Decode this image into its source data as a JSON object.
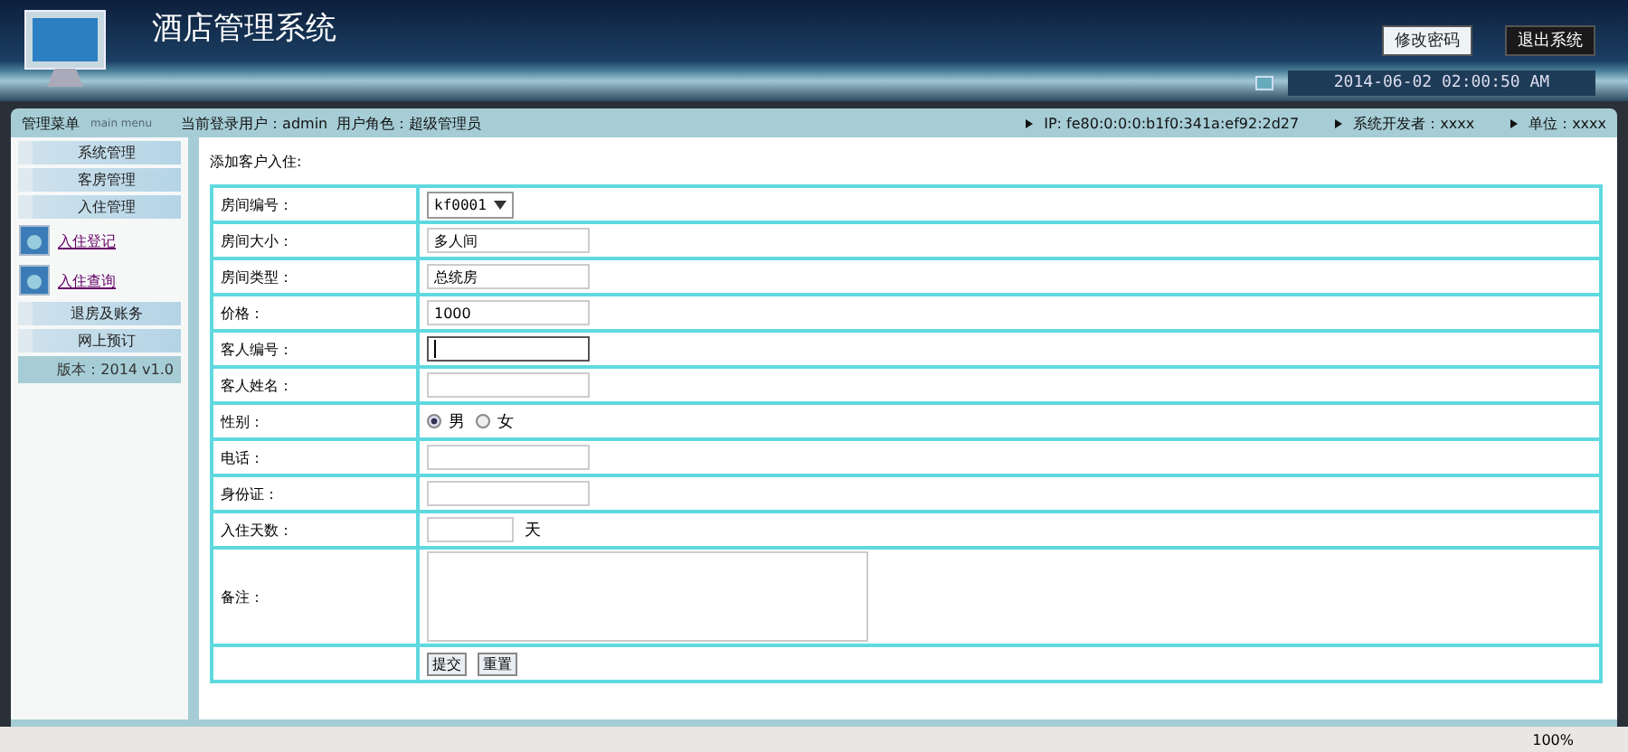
{
  "header": {
    "title": "酒店管理系统",
    "buttons": [
      {
        "label": "修改密码",
        "kind": "light"
      },
      {
        "label": "退出系统",
        "kind": "dark"
      }
    ],
    "datetime": "2014-06-02 02:00:50 AM"
  },
  "menu_bar": {
    "title": "管理菜单",
    "subtitle": "main menu",
    "user": "当前登录用户：admin  用户角色：超级管理员",
    "info": [
      "IP: fe80:0:0:0:b1f0:341a:ef92:2d27",
      "系统开发者：xxxx",
      "单位：xxxx"
    ]
  },
  "sidebar": {
    "items": [
      {
        "kind": "section",
        "label": "系统管理"
      },
      {
        "kind": "section",
        "label": "客房管理"
      },
      {
        "kind": "section",
        "label": "入住管理"
      },
      {
        "kind": "link",
        "label": "入住登记"
      },
      {
        "kind": "link",
        "label": "入住查询"
      },
      {
        "kind": "section",
        "label": "退房及账务"
      },
      {
        "kind": "section",
        "label": "网上预订"
      }
    ],
    "version": "版本：2014 v1.0"
  },
  "form": {
    "title": "添加客户入住:",
    "rows": [
      {
        "kind": "select",
        "label": "房间编号：",
        "value": "kf0001"
      },
      {
        "kind": "text",
        "label": "房间大小：",
        "value": "多人间",
        "focused": false
      },
      {
        "kind": "text",
        "label": "房间类型：",
        "value": "总统房",
        "focused": false
      },
      {
        "kind": "text",
        "label": "价格：",
        "value": "1000",
        "focused": false
      },
      {
        "kind": "text",
        "label": "客人编号：",
        "value": "",
        "focused": true
      },
      {
        "kind": "text",
        "label": "客人姓名：",
        "value": "",
        "focused": false
      },
      {
        "kind": "radio",
        "label": "性别：",
        "options": [
          {
            "label": "男",
            "selected": true
          },
          {
            "label": "女",
            "selected": false
          }
        ]
      },
      {
        "kind": "text",
        "label": "电话：",
        "value": "",
        "focused": false
      },
      {
        "kind": "text",
        "label": "身份证：",
        "value": "",
        "focused": false
      },
      {
        "kind": "unit",
        "label": "入住天数：",
        "value": "",
        "unit": "天"
      },
      {
        "kind": "textarea",
        "label": "备注：",
        "value": ""
      },
      {
        "kind": "buttons",
        "label": "",
        "buttons": [
          "提交",
          "重置"
        ]
      }
    ]
  },
  "status_bar": {
    "zoom": "100%"
  }
}
